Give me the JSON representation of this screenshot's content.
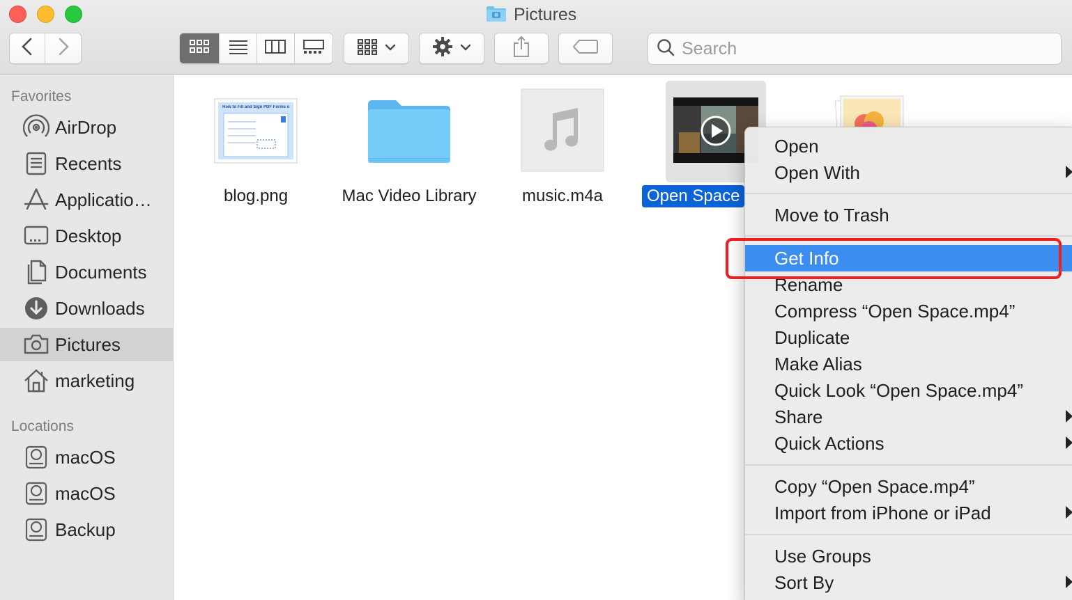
{
  "window": {
    "title": "Pictures",
    "title_icon": "camera-folder-icon"
  },
  "toolbar": {
    "back_icon": "chevron-left-icon",
    "forward_icon": "chevron-right-icon",
    "view_modes": [
      "icon-view-icon",
      "list-view-icon",
      "column-view-icon",
      "gallery-view-icon"
    ],
    "group_icon": "group-grid-icon",
    "action_icon": "gear-icon",
    "share_icon": "share-icon",
    "tag_icon": "tag-icon",
    "search": {
      "placeholder": "Search",
      "value": ""
    }
  },
  "sidebar": {
    "favorites_header": "Favorites",
    "favorites": [
      {
        "label": "AirDrop",
        "icon": "airdrop-icon"
      },
      {
        "label": "Recents",
        "icon": "recents-icon"
      },
      {
        "label": "Applicatio…",
        "icon": "applications-icon"
      },
      {
        "label": "Desktop",
        "icon": "desktop-icon"
      },
      {
        "label": "Documents",
        "icon": "documents-icon"
      },
      {
        "label": "Downloads",
        "icon": "downloads-icon"
      },
      {
        "label": "Pictures",
        "icon": "camera-icon",
        "selected": true
      },
      {
        "label": "marketing",
        "icon": "home-icon"
      }
    ],
    "locations_header": "Locations",
    "locations": [
      {
        "label": "macOS",
        "icon": "disk-icon"
      },
      {
        "label": "macOS",
        "icon": "disk-icon"
      },
      {
        "label": "Backup",
        "icon": "disk-icon"
      }
    ]
  },
  "files": [
    {
      "name": "blog.png",
      "icon": "image-thumbnail-icon",
      "thumb_text": "How to Fill and Sign PDF Forms on Mac?"
    },
    {
      "name": "Mac Video Library",
      "icon": "folder-icon"
    },
    {
      "name": "music.m4a",
      "icon": "music-note-icon"
    },
    {
      "name": "Open Space",
      "icon": "video-thumbnail-icon",
      "selected": true
    },
    {
      "name": "",
      "icon": "photos-library-icon"
    }
  ],
  "context_menu": {
    "items": [
      {
        "label": "Open"
      },
      {
        "label": "Open With",
        "submenu": true
      },
      {
        "label": "Move to Trash"
      },
      {
        "label": "Get Info",
        "highlighted": true
      },
      {
        "label": "Rename"
      },
      {
        "label": "Compress “Open Space.mp4”"
      },
      {
        "label": "Duplicate"
      },
      {
        "label": "Make Alias"
      },
      {
        "label": "Quick Look “Open Space.mp4”"
      },
      {
        "label": "Share",
        "submenu": true
      },
      {
        "label": "Quick Actions",
        "submenu": true
      },
      {
        "label": "Copy “Open Space.mp4”"
      },
      {
        "label": "Import from iPhone or iPad",
        "submenu": true
      },
      {
        "label": "Use Groups"
      },
      {
        "label": "Sort By",
        "submenu": true
      }
    ]
  },
  "colors": {
    "selection_blue": "#0a64d8",
    "menu_highlight": "#3b8df0",
    "annotation_red": "#f01e1e",
    "folder_blue": "#6cc6f7"
  }
}
